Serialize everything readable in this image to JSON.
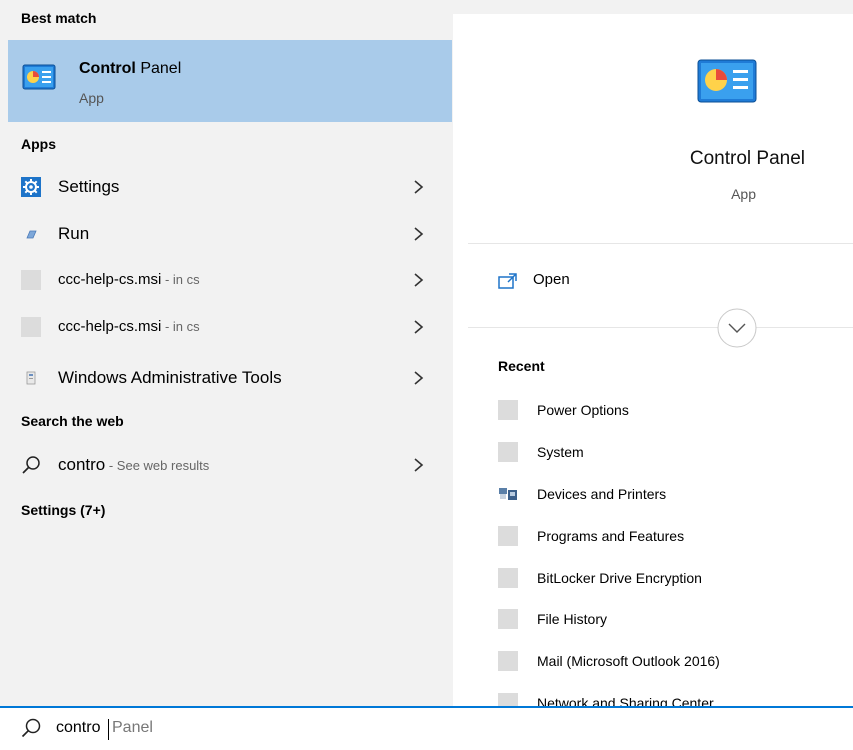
{
  "left": {
    "best_match_heading": "Best match",
    "best_match": {
      "title_bold": "Control",
      "title_rest": " Panel",
      "subtitle": "App",
      "icon": "control-panel-icon"
    },
    "apps_heading": "Apps",
    "apps": [
      {
        "label": "Settings",
        "hint": "",
        "icon": "settings-gear-icon"
      },
      {
        "label": "Run",
        "hint": "",
        "icon": "run-icon"
      },
      {
        "label": "ccc-help-cs.msi",
        "hint": " - in cs",
        "icon": "msi-file-icon"
      },
      {
        "label": "ccc-help-cs.msi",
        "hint": " - in cs",
        "icon": "msi-file-icon"
      },
      {
        "label": "Windows Administrative Tools",
        "hint": "",
        "icon": "admin-tools-icon"
      }
    ],
    "web_heading": "Search the web",
    "web": {
      "label": "contro",
      "hint": " - See web results",
      "icon": "search-icon"
    },
    "settings_heading": "Settings (7+)"
  },
  "right": {
    "app_title": "Control Panel",
    "app_type": "App",
    "open_label": "Open",
    "recent_heading": "Recent",
    "recent": [
      {
        "label": "Power Options",
        "icon": "blank-icon"
      },
      {
        "label": "System",
        "icon": "blank-icon"
      },
      {
        "label": "Devices and Printers",
        "icon": "devices-printers-icon"
      },
      {
        "label": "Programs and Features",
        "icon": "blank-icon"
      },
      {
        "label": "BitLocker Drive Encryption",
        "icon": "blank-icon"
      },
      {
        "label": "File History",
        "icon": "blank-icon"
      },
      {
        "label": "Mail (Microsoft Outlook 2016)",
        "icon": "blank-icon"
      },
      {
        "label": "Network and Sharing Center",
        "icon": "blank-icon"
      }
    ]
  },
  "search": {
    "typed": "contro",
    "suggestion": "Panel"
  },
  "colors": {
    "selected": "#a9cbea",
    "accent": "#0078d7",
    "panel": "#f2f2f2"
  }
}
